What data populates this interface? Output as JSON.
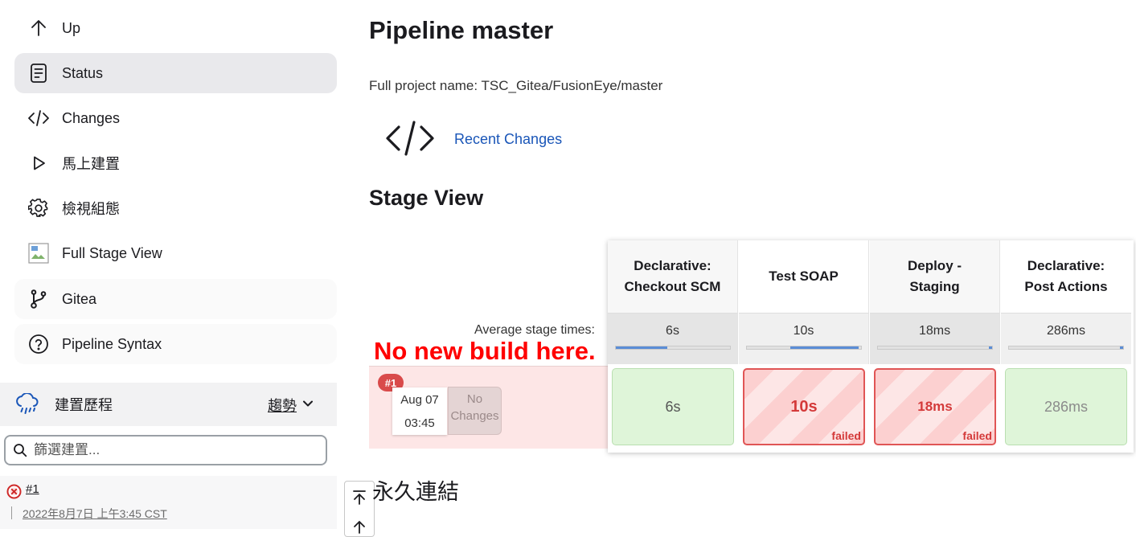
{
  "sidebar": {
    "items": [
      {
        "label": "Up",
        "icon": "arrow-up-icon"
      },
      {
        "label": "Status",
        "icon": "document-icon"
      },
      {
        "label": "Changes",
        "icon": "code-icon"
      },
      {
        "label": "馬上建置",
        "icon": "play-icon"
      },
      {
        "label": "檢視組態",
        "icon": "gear-icon"
      },
      {
        "label": "Full Stage View",
        "icon": "broken-image-icon"
      },
      {
        "label": "Gitea",
        "icon": "git-branch-icon"
      },
      {
        "label": "Pipeline Syntax",
        "icon": "help-circle-icon"
      }
    ],
    "history": {
      "title": "建置歷程",
      "trend": "趨勢",
      "filter_placeholder": "篩選建置...",
      "builds": [
        {
          "number": "#1",
          "time": "2022年8月7日 上午3:45 CST",
          "status": "failed"
        }
      ]
    }
  },
  "main": {
    "title": "Pipeline master",
    "project_name": "Full project name: TSC_Gitea/FusionEye/master",
    "recent_changes": "Recent Changes",
    "stage_view_title": "Stage View",
    "avg_label": "Average stage times:",
    "annotation": "No new build here.",
    "permalinks_title": "永久連結",
    "build": {
      "badge": "#1",
      "date": "Aug 07",
      "time": "03:45",
      "changes_line1": "No",
      "changes_line2": "Changes"
    },
    "stages": [
      {
        "name_line1": "Declarative:",
        "name_line2": "Checkout SCM",
        "avg": "6s",
        "avg_fill_start": 0.0,
        "avg_fill_end": 0.45,
        "result": "6s",
        "status": "success"
      },
      {
        "name_line1": "Test SOAP",
        "name_line2": "",
        "avg": "10s",
        "avg_fill_start": 0.38,
        "avg_fill_end": 0.98,
        "result": "10s",
        "status": "failed"
      },
      {
        "name_line1": "Deploy -",
        "name_line2": "Staging",
        "avg": "18ms",
        "avg_fill_start": 0.97,
        "avg_fill_end": 1.0,
        "result": "18ms",
        "status": "failed"
      },
      {
        "name_line1": "Declarative:",
        "name_line2": "Post Actions",
        "avg": "286ms",
        "avg_fill_start": 0.97,
        "avg_fill_end": 1.0,
        "result": "286ms",
        "status": "success"
      }
    ],
    "failed_tag": "failed"
  }
}
